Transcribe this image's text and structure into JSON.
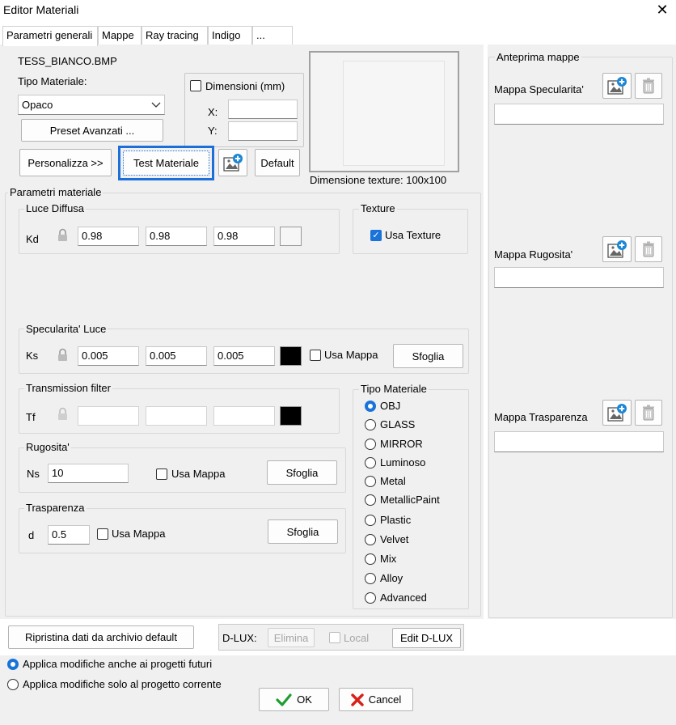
{
  "window": {
    "title": "Editor Materiali"
  },
  "tabs": [
    {
      "label": "Parametri generali"
    },
    {
      "label": "Mappe"
    },
    {
      "label": "Ray tracing"
    },
    {
      "label": "Indigo"
    },
    {
      "label": "..."
    }
  ],
  "general": {
    "file_name": "TESS_BIANCO.BMP",
    "tipo_materiale_label": "Tipo Materiale:",
    "tipo_materiale_value": "Opaco",
    "preset_button": "Preset Avanzati ...",
    "dimensioni_label": "Dimensioni (mm)",
    "x_label": "X:",
    "y_label": "Y:",
    "x_value": "",
    "y_value": "",
    "personalizza_button": "Personalizza >>",
    "test_button": "Test Materiale",
    "default_button": "Default",
    "texture_dimension": "Dimensione texture:  100x100"
  },
  "params": {
    "group_label": "Parametri materiale",
    "diffuse": {
      "label": "Luce Diffusa",
      "prefix": "Kd",
      "values": [
        "0.98",
        "0.98",
        "0.98"
      ],
      "color": "#f6f6f6"
    },
    "texture": {
      "label": "Texture",
      "use_label": "Usa Texture",
      "checked": true
    },
    "specular": {
      "label": "Specularita' Luce",
      "prefix": "Ks",
      "values": [
        "0.005",
        "0.005",
        "0.005"
      ],
      "color": "#000000",
      "use_map_label": "Usa Mappa",
      "browse": "Sfoglia"
    },
    "transmission": {
      "label": "Transmission filter",
      "prefix": "Tf",
      "values": [
        "",
        "",
        ""
      ],
      "color": "#000000"
    },
    "roughness": {
      "label": "Rugosita'",
      "prefix": "Ns",
      "value": "10",
      "use_map_label": "Usa Mappa",
      "browse": "Sfoglia"
    },
    "transparency": {
      "label": "Trasparenza",
      "prefix": "d",
      "value": "0.5",
      "use_map_label": "Usa Mappa",
      "browse": "Sfoglia"
    },
    "material_type": {
      "label": "Tipo Materiale",
      "options": [
        "OBJ",
        "GLASS",
        "MIRROR",
        "Luminoso",
        "Metal",
        "MetallicPaint",
        "Plastic",
        "Velvet",
        "Mix",
        "Alloy",
        "Advanced"
      ],
      "selected": "OBJ"
    }
  },
  "maps_preview": {
    "label": "Anteprima mappe",
    "specular": {
      "label": "Mappa Specularita'",
      "value": ""
    },
    "roughness": {
      "label": "Mappa Rugosita'",
      "value": ""
    },
    "transparency": {
      "label": "Mappa Trasparenza",
      "value": ""
    }
  },
  "bottom": {
    "restore_button": "Ripristina dati da archivio default",
    "dlux_label": "D-LUX:",
    "elimina_button": "Elimina",
    "local_label": "Local",
    "edit_dlux_button": "Edit D-LUX"
  },
  "footer": {
    "apply_future": "Applica modifiche anche ai progetti futuri",
    "apply_current": "Applica modifiche solo al progetto corrente",
    "apply_selected": "future",
    "ok_button": "OK",
    "cancel_button": "Cancel",
    "ok_color": "#1e9e2e",
    "cancel_color": "#d8201a"
  },
  "icons": {
    "close": "close-icon",
    "dropdown": "chevron-down-icon",
    "add_image": "add-image-icon",
    "trash": "trash-icon",
    "lock": "lock-icon",
    "ok": "checkmark-icon",
    "cancel": "x-mark-icon"
  }
}
